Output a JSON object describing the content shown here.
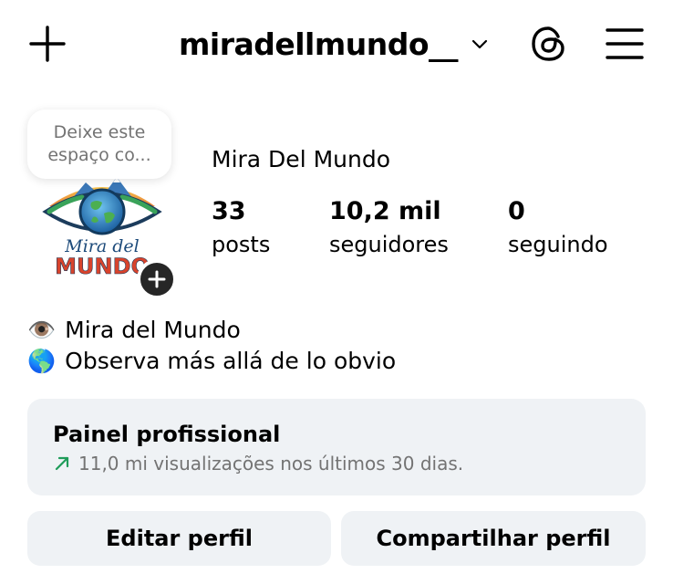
{
  "header": {
    "username": "miradellmundo__",
    "icons": {
      "create": "plus-icon",
      "account_switcher": "chevron-down-icon",
      "threads": "threads-icon",
      "menu": "hamburger-menu-icon"
    }
  },
  "profile": {
    "note_bubble": {
      "line1": "Deixe este",
      "line2": "espaço co..."
    },
    "avatar": {
      "logo_line1": "Mira del",
      "logo_line2": "MUNDO",
      "add_icon": "plus-icon"
    },
    "display_name": "Mira Del Mundo",
    "stats": [
      {
        "value": "33",
        "label": "posts"
      },
      {
        "value": "10,2 mil",
        "label": "seguidores"
      },
      {
        "value": "0",
        "label": "seguindo"
      }
    ],
    "bio": [
      {
        "emoji": "👁️",
        "text": "Mira del Mundo"
      },
      {
        "emoji": "🌎",
        "text": "Observa más allá de lo obvio"
      }
    ]
  },
  "professional_panel": {
    "title": "Painel profissional",
    "trend_icon": "trend-up-arrow-icon",
    "subtitle": "11,0 mi visualizações nos últimos 30 dias."
  },
  "actions": {
    "edit": "Editar perfil",
    "share": "Compartilhar perfil"
  },
  "colors": {
    "background": "#ffffff",
    "panel_bg": "#eff2f5",
    "muted_text": "#737373",
    "trend_green": "#1f9c5a",
    "badge_dark": "#262626"
  }
}
